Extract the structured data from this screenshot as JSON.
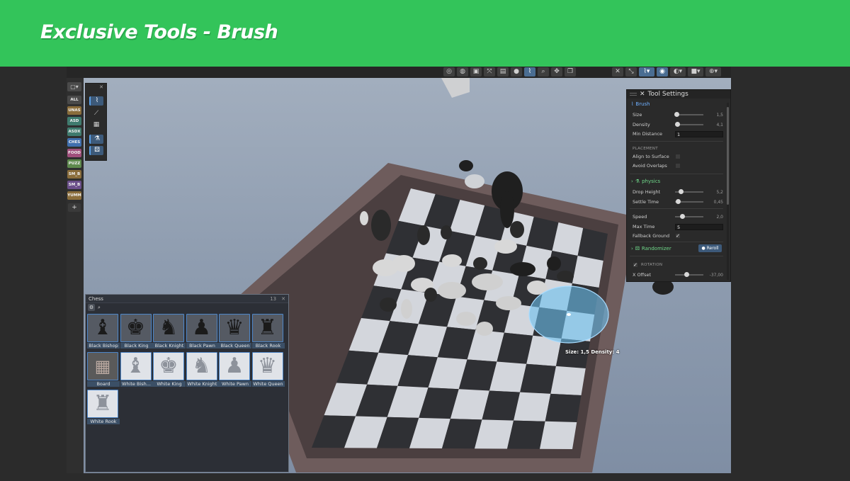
{
  "banner": {
    "title": "Exclusive Tools - Brush",
    "color": "#33c45a"
  },
  "layers": {
    "all": "ALL",
    "items": [
      {
        "code": "UNAS",
        "color": "#8a6d3b"
      },
      {
        "code": "ASD",
        "color": "#3f7b6e"
      },
      {
        "code": "ASDX",
        "color": "#3f7b6e"
      },
      {
        "code": "CHES",
        "color": "#3f6fae"
      },
      {
        "code": "FOOD",
        "color": "#a04f7c"
      },
      {
        "code": "PUZZ",
        "color": "#5e8a4d"
      },
      {
        "code": "SM_B",
        "color": "#8a6d3b"
      },
      {
        "code": "SM_B",
        "color": "#6b4f8a"
      },
      {
        "code": "YUMM",
        "color": "#8a6d3b"
      }
    ],
    "add": "+"
  },
  "tool_settings": {
    "title": "Tool Settings",
    "brush": {
      "label": "Brush",
      "size_label": "Size",
      "size": 1.5,
      "size_text": "1,5",
      "density_label": "Density",
      "density": 4.1,
      "density_text": "4,1",
      "min_distance_label": "Min Distance",
      "min_distance": "1"
    },
    "placement": {
      "label": "PLACEMENT",
      "align_label": "Align to Surface",
      "overlap_label": "Avoid Overlaps"
    },
    "physics": {
      "label": "physics",
      "drop_label": "Drop Height",
      "drop_text": "5,2",
      "settle_label": "Settle Time",
      "settle_text": "0,45",
      "speed_label": "Speed",
      "speed_text": "2,0",
      "maxtime_label": "Max Time",
      "maxtime": "5",
      "fallback_label": "Fallback Ground"
    },
    "randomizer": {
      "label": "Randomizer",
      "reroll": "Reroll"
    },
    "rotation": {
      "label": "ROTATION",
      "xoffset_label": "X Offset",
      "xoffset_text": "-37,00"
    }
  },
  "chess_panel": {
    "title": "Chess",
    "count": "13",
    "items": [
      {
        "label": "Black Bishop",
        "glyph": "♝",
        "tone": "dark"
      },
      {
        "label": "Black King",
        "glyph": "♚",
        "tone": "dark"
      },
      {
        "label": "Black Knight",
        "glyph": "♞",
        "tone": "dark"
      },
      {
        "label": "Black Pawn",
        "glyph": "♟",
        "tone": "dark"
      },
      {
        "label": "Black Queen",
        "glyph": "♛",
        "tone": "dark"
      },
      {
        "label": "Black Rook",
        "glyph": "♜",
        "tone": "dark"
      },
      {
        "label": "Board",
        "glyph": "▦",
        "tone": "board"
      },
      {
        "label": "White Bish...",
        "glyph": "♝",
        "tone": "light"
      },
      {
        "label": "White King",
        "glyph": "♚",
        "tone": "light"
      },
      {
        "label": "White Knight",
        "glyph": "♞",
        "tone": "light"
      },
      {
        "label": "White Pawn",
        "glyph": "♟",
        "tone": "light"
      },
      {
        "label": "White Queen",
        "glyph": "♛",
        "tone": "light"
      },
      {
        "label": "White Rook",
        "glyph": "♜",
        "tone": "light"
      }
    ]
  },
  "viewport": {
    "brush_readout": "Size: 1,5  Density: 4"
  }
}
